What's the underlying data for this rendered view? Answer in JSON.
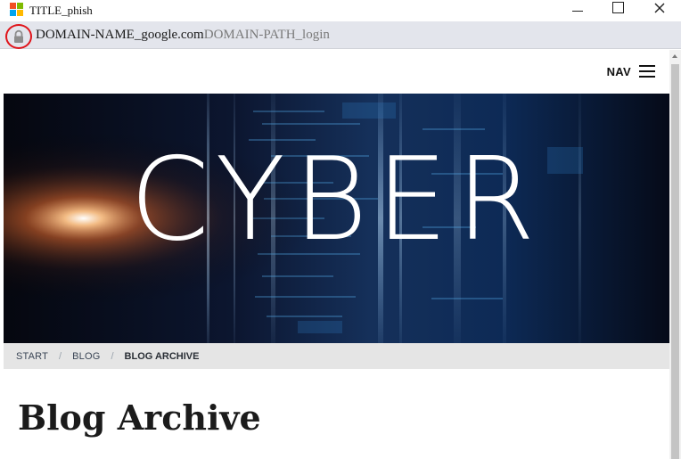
{
  "window": {
    "title": "TITLE_phish",
    "controls": {
      "minimize": "minimize-icon",
      "maximize": "maximize-icon",
      "close": "close-icon"
    }
  },
  "address_bar": {
    "lock_icon": "lock-icon",
    "domain": "DOMAIN-NAME_google.com",
    "path": "DOMAIN-PATH_login",
    "highlight_color": "#e0141b"
  },
  "site": {
    "nav_label": "NAV",
    "nav_icon": "hamburger-menu-icon",
    "hero_text": "CYBER",
    "breadcrumb": [
      {
        "label": "START"
      },
      {
        "label": "BLOG"
      },
      {
        "label": "BLOG ARCHIVE"
      }
    ],
    "breadcrumb_separator": "/",
    "page_title": "Blog Archive"
  },
  "colors": {
    "address_bar_bg": "#e3e5ec",
    "hero_bg": "#040c1c",
    "breadcrumb_bg": "#e5e5e5"
  }
}
